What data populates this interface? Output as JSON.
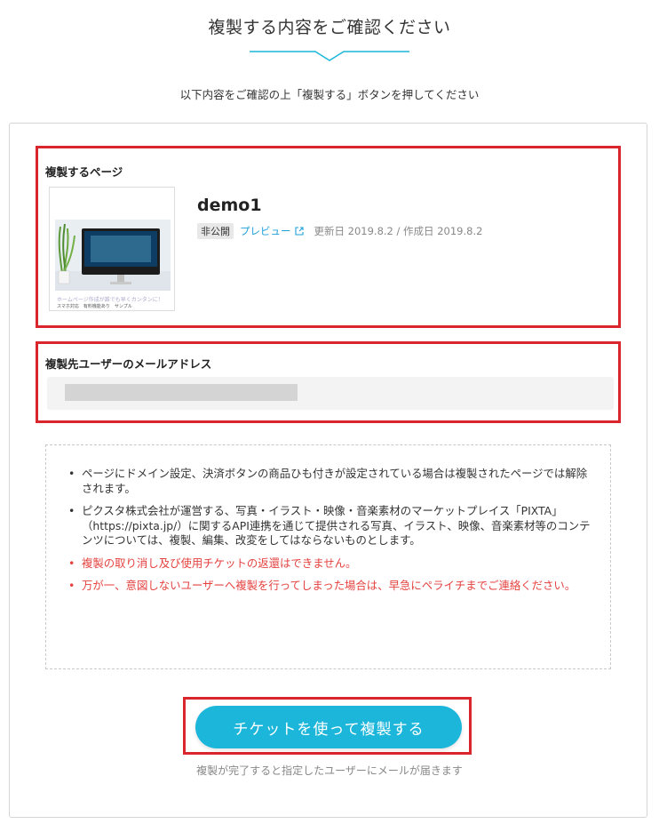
{
  "header": {
    "title": "複製する内容をご確認ください",
    "subtitle": "以下内容をご確認の上「複製する」ボタンを押してください"
  },
  "page_section": {
    "label": "複製するページ",
    "thumbnail": {
      "caption_line1": "ホームページ作成が誰でも早くカンタンに！",
      "caption_line2": "スマホ対応　有料機能あり　サンプル"
    },
    "page_name": "demo1",
    "status_badge": "非公開",
    "preview_link": "プレビュー",
    "dates": "更新日 2019.8.2 / 作成日 2019.8.2"
  },
  "email_section": {
    "label": "複製先ユーザーのメールアドレス",
    "value": ""
  },
  "notes": [
    {
      "text": "ページにドメイン設定、決済ボタンの商品ひも付きが設定されている場合は複製されたページでは解除されます。",
      "warning": false
    },
    {
      "text": "ピクスタ株式会社が運営する、写真・イラスト・映像・音楽素材のマーケットプレイス「PIXTA」（https://pixta.jp/）に関するAPI連携を通じて提供される写真、イラスト、映像、音楽素材等のコンテンツについては、複製、編集、改変をしてはならないものとします。",
      "warning": false
    },
    {
      "text": "複製の取り消し及び使用チケットの返還はできません。",
      "warning": true
    },
    {
      "text": "万が一、意図しないユーザーへ複製を行ってしまった場合は、早急にペライチまでご連絡ください。",
      "warning": true
    }
  ],
  "action": {
    "button_label": "チケットを使って複製する",
    "note": "複製が完了すると指定したユーザーにメールが届きます"
  },
  "colors": {
    "accent": "#1bb6da",
    "highlight_red": "#d9262c",
    "warning_red": "#e4423f",
    "link_blue": "#1e9fd8"
  }
}
